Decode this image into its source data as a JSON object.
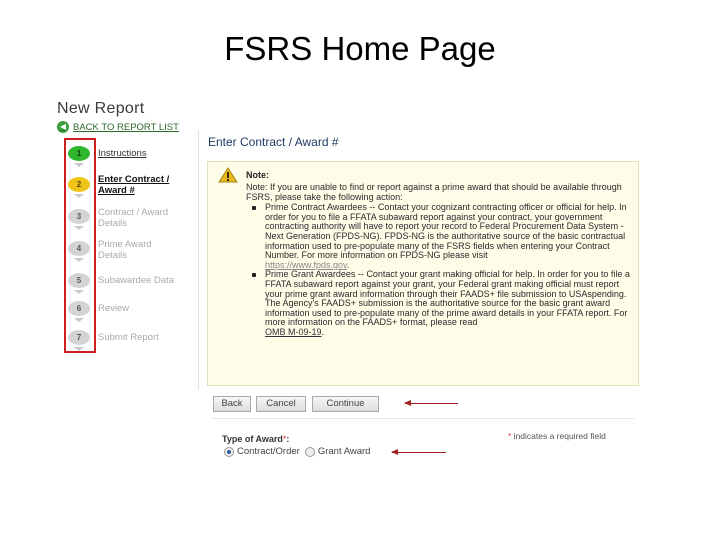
{
  "slide": {
    "title": "FSRS Home Page"
  },
  "page": {
    "heading": "New Report",
    "back_link": "BACK TO REPORT LIST"
  },
  "steps": [
    {
      "number": "1",
      "label_line1": "Instructions",
      "label_line2": "",
      "state": "done"
    },
    {
      "number": "2",
      "label_line1": "Enter Contract /",
      "label_line2": "Award #",
      "state": "active"
    },
    {
      "number": "3",
      "label_line1": "Contract / Award",
      "label_line2": "Details",
      "state": "pending"
    },
    {
      "number": "4",
      "label_line1": "Prime Award",
      "label_line2": "Details",
      "state": "pending"
    },
    {
      "number": "5",
      "label_line1": "Subawardee Data",
      "label_line2": "",
      "state": "pending"
    },
    {
      "number": "6",
      "label_line1": "Review",
      "label_line2": "",
      "state": "pending"
    },
    {
      "number": "7",
      "label_line1": "Submit Report",
      "label_line2": "",
      "state": "pending"
    }
  ],
  "main": {
    "section_title": "Enter Contract / Award #",
    "note": {
      "heading": "Note:",
      "intro": "Note: If you are unable to find or report against a prime award that should be available through FSRS, please take the following action:",
      "items": [
        {
          "text": "Prime Contract Awardees -- Contact your cognizant contracting officer or official for help. In order for you to file a FFATA subaward report against your contract, your government contracting authority will have to report your record to Federal Procurement Data System -Next Generation (FPDS-NG). FPDS-NG is the authoritative source of the basic contractual information used to pre-populate many of the FSRS fields when entering your Contract Number. For more information on FPDS-NG please visit",
          "link": "https://www.fpds.gov",
          "suffix": "."
        },
        {
          "text": "Prime Grant Awardees -- Contact your grant making official for help. In order for you to file a FFATA subaward report against your grant, your Federal grant making official must report your prime grant award information through their FAADS+ file submission to USAspending. The Agency's FAADS+ submission is the authoritative source for the basic grant award information used to pre-populate many of the prime award details in your FFATA report. For more information on the FAADS+ format, please read",
          "link": "OMB M-09-19",
          "suffix": "."
        }
      ]
    },
    "buttons": {
      "back": "Back",
      "cancel": "Cancel",
      "continue": "Continue"
    },
    "required_note": {
      "star": "*",
      "text": " indicates a required field"
    },
    "award_type": {
      "label": "Type of Award",
      "star": "*",
      "colon": ":",
      "options": [
        {
          "label": "Contract/Order",
          "checked": true
        },
        {
          "label": "Grant Award",
          "checked": false
        }
      ]
    }
  },
  "colors": {
    "step_done": "#2fb62f",
    "step_active": "#f0c419",
    "highlight_box": "#cc1f1f",
    "note_background": "#fefde8",
    "arrow": "#a12222"
  }
}
